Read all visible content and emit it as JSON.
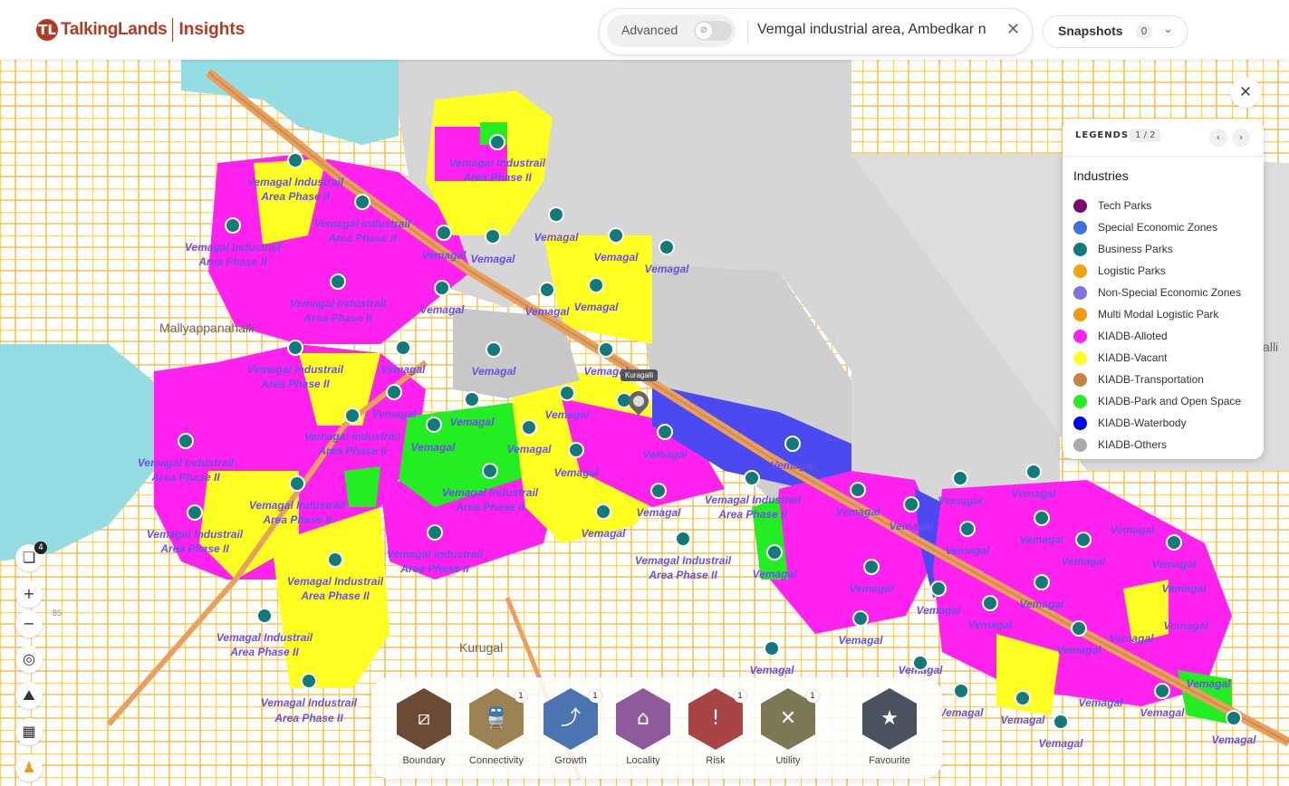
{
  "header": {
    "logo_mark": "TL",
    "logo_text": "TalkingLands",
    "logo_sub": "Insights",
    "advanced_label": "Advanced",
    "search_value": "Vemgal industrial area, Ambedkar n",
    "snapshots_label": "Snapshots",
    "snapshots_count": "0"
  },
  "legend": {
    "title": "LEGENDS",
    "page": "1 / 2",
    "category": "Industries",
    "items": [
      {
        "label": "Tech Parks",
        "color": "#7a0a6e"
      },
      {
        "label": "Special Economic Zones",
        "color": "#3f6fe0"
      },
      {
        "label": "Business Parks",
        "color": "#137a7a"
      },
      {
        "label": "Logistic Parks",
        "color": "#f5a30a"
      },
      {
        "label": "Non-Special Economic Zones",
        "color": "#8470e0"
      },
      {
        "label": "Multi Modal Logistic Park",
        "color": "#f59a0a"
      },
      {
        "label": "KIADB-Alloted",
        "color": "#ff22ee"
      },
      {
        "label": "KIADB-Vacant",
        "color": "#ffff22"
      },
      {
        "label": "KIADB-Transportation",
        "color": "#c68544"
      },
      {
        "label": "KIADB-Park and Open Space",
        "color": "#22ee22"
      },
      {
        "label": "KIADB-Waterbody",
        "color": "#0000ee"
      },
      {
        "label": "KIADB-Others",
        "color": "#aaaaaa"
      }
    ]
  },
  "map": {
    "layer_count": "4",
    "pin_label": "Kuragalli",
    "place_names": [
      "Mallyappanahalli",
      "Kurugal",
      "Perjenahalli"
    ],
    "region_label_primary": "Vemagal Industrail",
    "region_label_secondary": "Area Phase II",
    "town_label": "Vemagal",
    "road_shield": "85"
  },
  "dock": {
    "items": [
      {
        "label": "Boundary",
        "badge": "",
        "color": "#6b4a36",
        "icon": "boundary-icon"
      },
      {
        "label": "Connectivity",
        "badge": "1",
        "color": "#9c8152",
        "icon": "train-icon"
      },
      {
        "label": "Growth",
        "badge": "1",
        "color": "#4b74b0",
        "icon": "growth-icon"
      },
      {
        "label": "Locality",
        "badge": "",
        "color": "#8e5a9c",
        "icon": "locality-icon"
      },
      {
        "label": "Risk",
        "badge": "1",
        "color": "#a84444",
        "icon": "risk-icon"
      },
      {
        "label": "Utility",
        "badge": "1",
        "color": "#7c7854",
        "icon": "utility-icon"
      },
      {
        "label": "Favourite",
        "badge": "",
        "color": "#4c5160",
        "icon": "star-icon"
      }
    ]
  }
}
